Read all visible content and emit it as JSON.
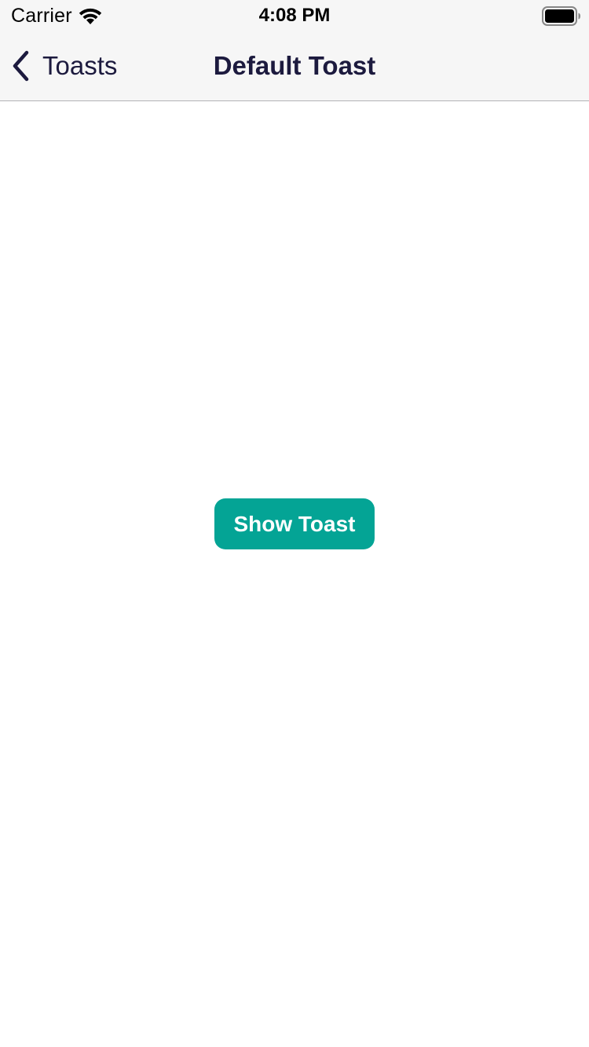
{
  "status_bar": {
    "carrier": "Carrier",
    "time": "4:08 PM",
    "wifi_icon": "wifi-icon",
    "battery_icon": "battery-full-icon"
  },
  "nav_bar": {
    "back_label": "Toasts",
    "back_icon": "chevron-left-icon",
    "title": "Default Toast"
  },
  "main": {
    "show_toast_label": "Show Toast"
  },
  "colors": {
    "nav_background": "#f6f6f6",
    "nav_text": "#1c1a3e",
    "button_background": "#04a495",
    "button_text": "#ffffff",
    "page_background": "#ffffff"
  }
}
